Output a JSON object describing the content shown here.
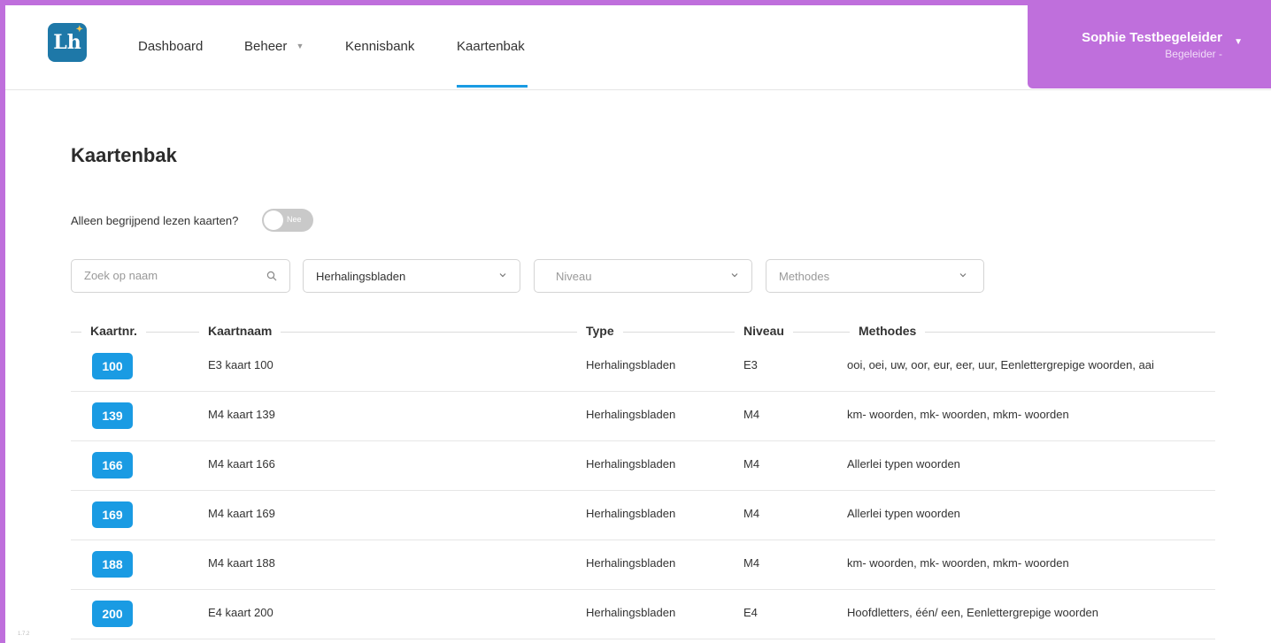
{
  "navbar": {
    "logo_text": "Lh",
    "items": [
      {
        "label": "Dashboard"
      },
      {
        "label": "Beheer"
      },
      {
        "label": "Kennisbank"
      },
      {
        "label": "Kaartenbak"
      }
    ],
    "active_item": "Kaartenbak",
    "user": {
      "name": "Sophie Testbegeleider",
      "role": "Begeleider -"
    }
  },
  "page": {
    "title": "Kaartenbak"
  },
  "toggle": {
    "label": "Alleen begrijpend lezen kaarten?",
    "state_text": "Nee",
    "checked": false
  },
  "filters": {
    "search": {
      "placeholder": "Zoek op naam",
      "value": ""
    },
    "type": {
      "value": "Herhalingsbladen"
    },
    "niveau": {
      "placeholder": "Niveau"
    },
    "methodes": {
      "placeholder": "Methodes"
    }
  },
  "table": {
    "headers": {
      "nr": "Kaartnr.",
      "name": "Kaartnaam",
      "type": "Type",
      "niveau": "Niveau",
      "methodes": "Methodes"
    },
    "rows": [
      {
        "nr": "100",
        "name": "E3 kaart 100",
        "type": "Herhalingsbladen",
        "niveau": "E3",
        "methodes": "ooi, oei, uw, oor, eur, eer, uur, Eenlettergrepige woorden, aai"
      },
      {
        "nr": "139",
        "name": "M4 kaart 139",
        "type": "Herhalingsbladen",
        "niveau": "M4",
        "methodes": "km- woorden, mk- woorden, mkm- woorden"
      },
      {
        "nr": "166",
        "name": "M4 kaart 166",
        "type": "Herhalingsbladen",
        "niveau": "M4",
        "methodes": "Allerlei typen woorden"
      },
      {
        "nr": "169",
        "name": "M4 kaart 169",
        "type": "Herhalingsbladen",
        "niveau": "M4",
        "methodes": "Allerlei typen woorden"
      },
      {
        "nr": "188",
        "name": "M4 kaart 188",
        "type": "Herhalingsbladen",
        "niveau": "M4",
        "methodes": "km- woorden, mk- woorden, mkm- woorden"
      },
      {
        "nr": "200",
        "name": "E4 kaart 200",
        "type": "Herhalingsbladen",
        "niveau": "E4",
        "methodes": "Hoofdletters, één/ een, Eenlettergrepige woorden"
      }
    ]
  },
  "version": "1.7.2",
  "colors": {
    "accent": "#1a9be3",
    "brand_purple": "#bf6fdc",
    "logo_blue": "#1e78a8"
  }
}
